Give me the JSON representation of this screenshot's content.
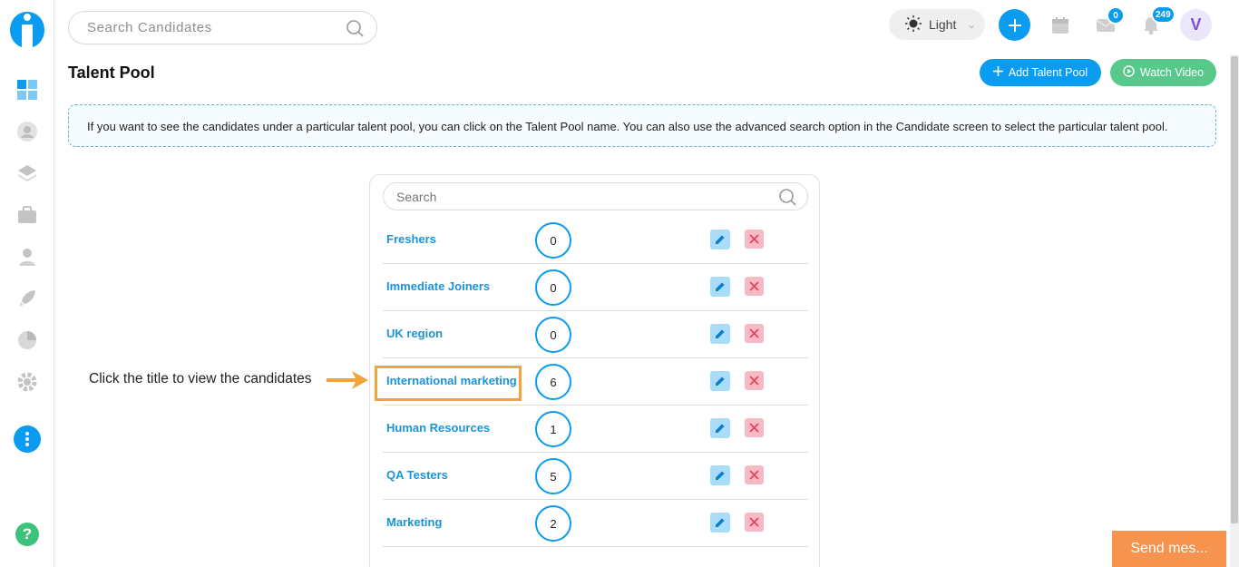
{
  "search": {
    "placeholder": "Search Candidates"
  },
  "header": {
    "theme_label": "Light",
    "mail_badge": "0",
    "notification_badge": "249",
    "avatar_initial": "V"
  },
  "page": {
    "title": "Talent Pool",
    "add_button_label": "Add Talent Pool",
    "watch_button_label": "Watch Video",
    "info_text": "If you want to see the candidates under a particular talent pool, you can click on the Talent Pool name. You can also use the advanced search option in the Candidate screen to select the particular talent pool."
  },
  "pool": {
    "search_placeholder": "Search",
    "rows": [
      {
        "name": "Freshers",
        "count": "0"
      },
      {
        "name": "Immediate Joiners",
        "count": "0"
      },
      {
        "name": "UK region",
        "count": "0"
      },
      {
        "name": "International marketing",
        "count": "6"
      },
      {
        "name": "Human Resources",
        "count": "1"
      },
      {
        "name": "QA Testers",
        "count": "5"
      },
      {
        "name": "Marketing",
        "count": "2"
      }
    ]
  },
  "annotation": {
    "text": "Click the title to view the candidates"
  },
  "chat": {
    "send_label": "Send mes..."
  },
  "colors": {
    "accent": "#0a9cf0",
    "success": "#58c98a",
    "highlight": "#f2a33a",
    "chat": "#f5934f"
  }
}
